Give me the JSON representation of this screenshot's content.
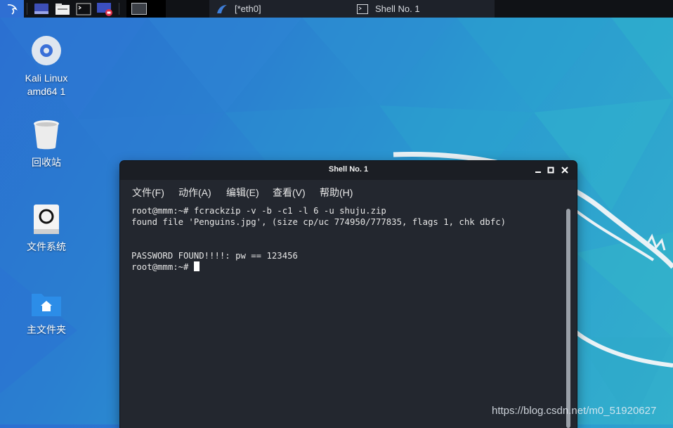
{
  "panel": {
    "tasks": [
      {
        "label": "[*eth0]",
        "icon": "wireshark-fin-icon"
      },
      {
        "label": "Shell No. 1",
        "icon": "terminal-icon"
      }
    ]
  },
  "desktop": {
    "icons": [
      {
        "label_line1": "Kali Linux",
        "label_line2": "amd64 1",
        "icon": "disc-icon"
      },
      {
        "label": "回收站",
        "icon": "trash-icon"
      },
      {
        "label": "文件系统",
        "icon": "drive-icon"
      },
      {
        "label": "主文件夹",
        "icon": "home-folder-icon"
      }
    ]
  },
  "terminal": {
    "title": "Shell No. 1",
    "menu": [
      "文件(F)",
      "动作(A)",
      "编辑(E)",
      "查看(V)",
      "帮助(H)"
    ],
    "lines": [
      "root@mmm:~# fcrackzip -v -b -c1 -l 6 -u shuju.zip",
      "found file 'Penguins.jpg', (size cp/uc 774950/777835, flags 1, chk dbfc)",
      "",
      "",
      "PASSWORD FOUND!!!!: pw == 123456"
    ],
    "prompt": "root@mmm:~# "
  },
  "watermark": "https://blog.csdn.net/m0_51920627",
  "colors": {
    "panel": "#101216",
    "terminal_bg": "#23272f",
    "accent": "#2f6fd3"
  }
}
